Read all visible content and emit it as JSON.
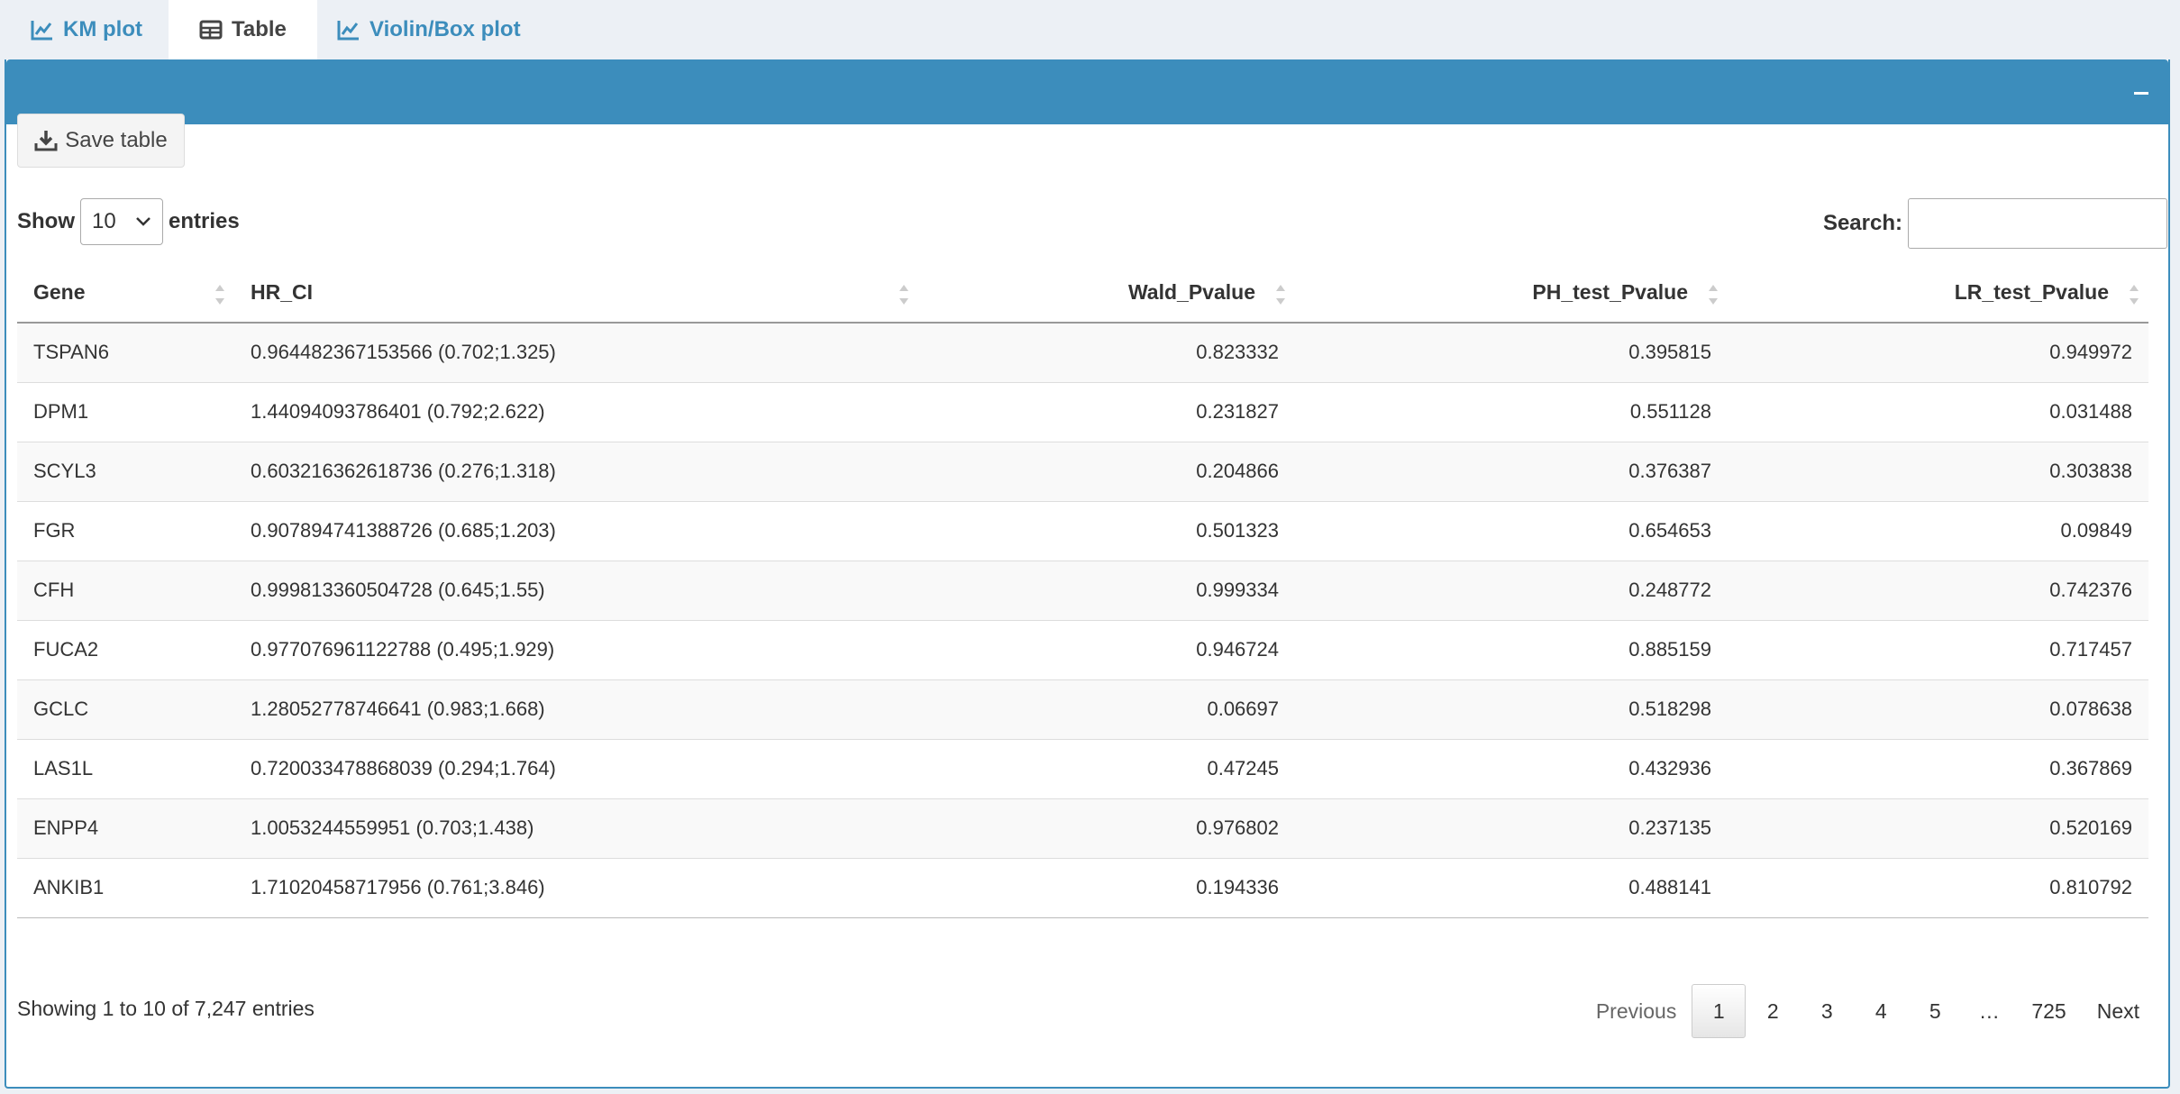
{
  "tabs": [
    {
      "label": "KM plot",
      "icon": "line-chart-icon"
    },
    {
      "label": "Table",
      "icon": "table-icon"
    },
    {
      "label": "Violin/Box plot",
      "icon": "line-chart-icon"
    }
  ],
  "active_tab": "Table",
  "colors": {
    "accent": "#3c8dbc",
    "background": "#ecf0f5"
  },
  "toolbar": {
    "save_label": "Save table",
    "save_icon": "download-icon"
  },
  "length_control": {
    "prefix": "Show",
    "value": "10",
    "suffix": "entries"
  },
  "search": {
    "label": "Search:",
    "value": "",
    "placeholder": ""
  },
  "table": {
    "columns": [
      "Gene",
      "HR_CI",
      "Wald_Pvalue",
      "PH_test_Pvalue",
      "LR_test_Pvalue"
    ],
    "rows": [
      [
        "TSPAN6",
        "0.964482367153566 (0.702;1.325)",
        "0.823332",
        "0.395815",
        "0.949972"
      ],
      [
        "DPM1",
        "1.44094093786401 (0.792;2.622)",
        "0.231827",
        "0.551128",
        "0.031488"
      ],
      [
        "SCYL3",
        "0.603216362618736 (0.276;1.318)",
        "0.204866",
        "0.376387",
        "0.303838"
      ],
      [
        "FGR",
        "0.907894741388726 (0.685;1.203)",
        "0.501323",
        "0.654653",
        "0.09849"
      ],
      [
        "CFH",
        "0.999813360504728 (0.645;1.55)",
        "0.999334",
        "0.248772",
        "0.742376"
      ],
      [
        "FUCA2",
        "0.977076961122788 (0.495;1.929)",
        "0.946724",
        "0.885159",
        "0.717457"
      ],
      [
        "GCLC",
        "1.28052778746641 (0.983;1.668)",
        "0.06697",
        "0.518298",
        "0.078638"
      ],
      [
        "LAS1L",
        "0.720033478868039 (0.294;1.764)",
        "0.47245",
        "0.432936",
        "0.367869"
      ],
      [
        "ENPP4",
        "1.0053244559951 (0.703;1.438)",
        "0.976802",
        "0.237135",
        "0.520169"
      ],
      [
        "ANKIB1",
        "1.71020458717956 (0.761;3.846)",
        "0.194336",
        "0.488141",
        "0.810792"
      ]
    ]
  },
  "info": "Showing 1 to 10 of 7,247 entries",
  "pagination": {
    "previous": "Previous",
    "pages": [
      "1",
      "2",
      "3",
      "4",
      "5",
      "…",
      "725"
    ],
    "current": "1",
    "next": "Next"
  }
}
